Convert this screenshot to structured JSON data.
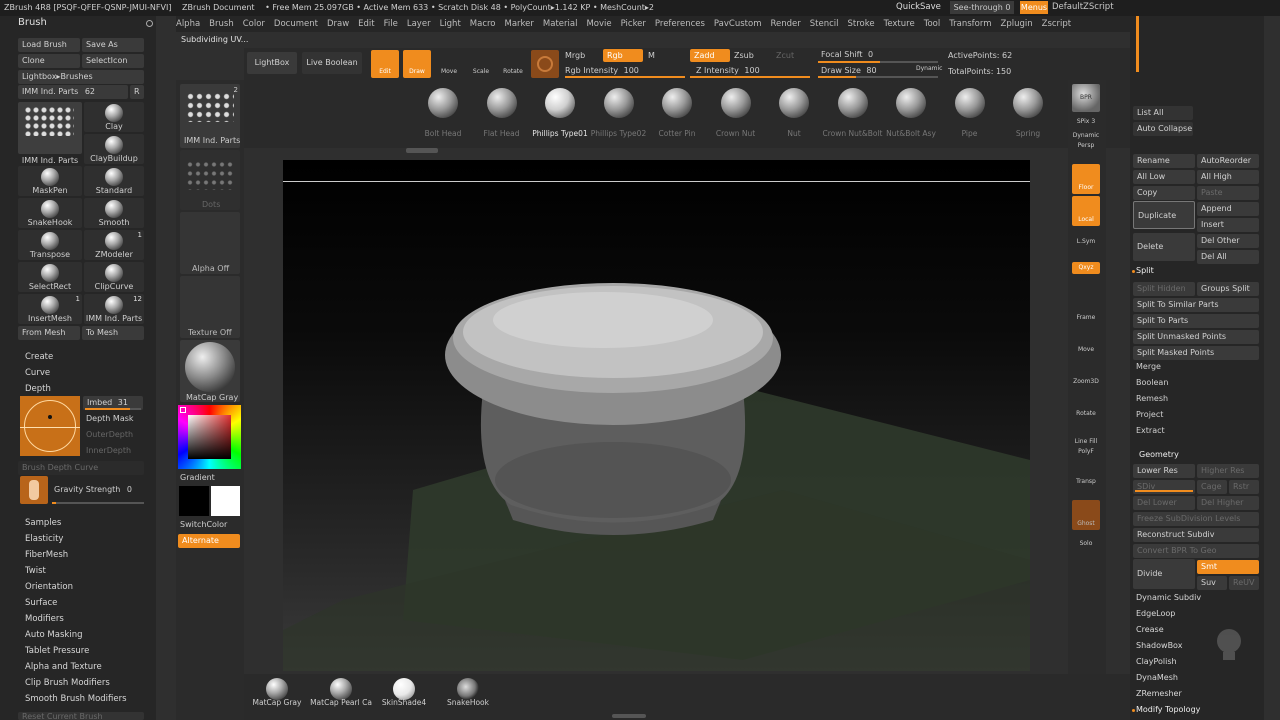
{
  "topbar": {
    "title": "ZBrush 4R8 [PSQF-QFEF-QSNP-JMUI-NFVI]",
    "doc": "ZBrush Document",
    "stats": "• Free Mem 25.097GB • Active Mem 633 • Scratch Disk 48 • PolyCount▸1.142 KP • MeshCount▸2",
    "quicksave": "QuickSave",
    "seethrough": "See-through 0",
    "menus": "Menus",
    "script": "DefaultZScript"
  },
  "menu": [
    "Alpha",
    "Brush",
    "Color",
    "Document",
    "Draw",
    "Edit",
    "File",
    "Layer",
    "Light",
    "Macro",
    "Marker",
    "Material",
    "Movie",
    "Picker",
    "Preferences",
    "PavCustom",
    "Render",
    "Stencil",
    "Stroke",
    "Texture",
    "Tool",
    "Transform",
    "Zplugin",
    "Zscript"
  ],
  "status": "Subdividing UV...",
  "brush": {
    "title": "Brush",
    "load": "Load Brush",
    "saveas": "Save As",
    "clone": "Clone",
    "selecticon": "SelectIcon",
    "lightbox": "Lightbox▸Brushes",
    "imm": "IMM Ind. Parts",
    "imm_value": "62",
    "r": "R",
    "grid": [
      {
        "label": "IMM Ind. Parts",
        "badge": ""
      },
      {
        "label": "Clay",
        "badge": ""
      },
      {
        "label": "ClayBuildup",
        "badge": ""
      },
      {
        "label": "MaskPen",
        "badge": ""
      },
      {
        "label": "Standard",
        "badge": ""
      },
      {
        "label": "SnakeHook",
        "badge": ""
      },
      {
        "label": "Smooth",
        "badge": ""
      },
      {
        "label": "Transpose",
        "badge": ""
      },
      {
        "label": "ZModeler",
        "badge": "1"
      },
      {
        "label": "SelectRect",
        "badge": ""
      },
      {
        "label": "ClipCurve",
        "badge": ""
      },
      {
        "label": "InsertMesh",
        "badge": "1"
      },
      {
        "label": "IMM Ind. Parts",
        "badge": "12"
      }
    ],
    "frommesh": "From Mesh",
    "tomesh": "To Mesh",
    "create": "Create",
    "curve": "Curve",
    "depth": "Depth",
    "embed": "Imbed",
    "embed_value": "31",
    "depthmask": "Depth Mask",
    "outerdepth": "OuterDepth",
    "innerdepth": "InnerDepth",
    "brushdepthcurve": "Brush Depth Curve",
    "gravity": "Gravity Strength",
    "gravity_value": "0",
    "sections": [
      "Samples",
      "Elasticity",
      "FiberMesh",
      "Twist",
      "Orientation",
      "Surface",
      "Modifiers",
      "Auto Masking",
      "Tablet Pressure",
      "Alpha and Texture",
      "Clip Brush Modifiers",
      "Smooth Brush Modifiers"
    ],
    "reset": "Reset Current Brush"
  },
  "shelf": {
    "imm": "IMM Ind. Parts",
    "imm_badge": "2",
    "dots": "Dots",
    "alpha": "Alpha Off",
    "texture": "Texture Off",
    "matcap": "MatCap Gray",
    "gradient": "Gradient",
    "switchcolor": "SwitchColor",
    "alternate": "Alternate"
  },
  "toolbar": {
    "lightbox": "LightBox",
    "liveboolean": "Live Boolean",
    "edit": "Edit",
    "draw": "Draw",
    "move": "Move",
    "scale": "Scale",
    "rotate": "Rotate",
    "mrgb": "Mrgb",
    "rgb": "Rgb",
    "m": "M",
    "zadd": "Zadd",
    "zsub": "Zsub",
    "zcut": "Zcut",
    "rgbint": "Rgb Intensity",
    "rgbint_value": "100",
    "zint": "Z Intensity",
    "zint_value": "100",
    "focal": "Focal Shift",
    "focal_value": "0",
    "drawsize": "Draw Size",
    "drawsize_value": "80",
    "dynamic": "Dynamic",
    "activepoints": "ActivePoints: 62",
    "totalpoints": "TotalPoints: 150"
  },
  "tools": [
    "Bolt Head",
    "Flat Head",
    "Phillips Type01",
    "Phillips Type02",
    "Cotter Pin",
    "Crown Nut",
    "Nut",
    "Crown Nut&Bolt",
    "Nut&Bolt Asy",
    "Pipe",
    "Spring"
  ],
  "rightshelf": {
    "bpr": "BPR",
    "spix": "SPix",
    "spix_value": "3",
    "dynamic": "Dynamic",
    "persp": "Persp",
    "floor": "Floor",
    "local": "Local",
    "lsym": "L.Sym",
    "xyz": "Qxyz",
    "frame": "Frame",
    "move": "Move",
    "zoom": "Zoom3D",
    "rotate": "Rotate",
    "linefill": "Line Fill",
    "polyf": "PolyF",
    "transp": "Transp",
    "ghost": "Ghost",
    "solo": "Solo"
  },
  "subtool": {
    "listall": "List All",
    "autocollapse": "Auto Collapse",
    "rename": "Rename",
    "autoreorder": "AutoReorder",
    "alllow": "All Low",
    "allhigh": "All High",
    "copy": "Copy",
    "paste": "Paste",
    "duplicate": "Duplicate",
    "append": "Append",
    "insert": "Insert",
    "delete": "Delete",
    "delother": "Del Other",
    "delall": "Del All",
    "split": "Split",
    "splithidden": "Split Hidden",
    "groupssplit": "Groups Split",
    "splitsimilar": "Split To Similar Parts",
    "splitparts": "Split To Parts",
    "splitunmasked": "Split Unmasked Points",
    "splitmasked": "Split Masked Points",
    "merge": "Merge",
    "boolean": "Boolean",
    "remesh": "Remesh",
    "project": "Project",
    "extract": "Extract"
  },
  "geometry": {
    "title": "Geometry",
    "lowerres": "Lower Res",
    "higherres": "Higher Res",
    "sdiv": "SDiv",
    "cage": "Cage",
    "rstr": "Rstr",
    "dellower": "Del Lower",
    "delhigher": "Del Higher",
    "freeze": "Freeze SubDivision Levels",
    "reconstruct": "Reconstruct Subdiv",
    "convertbpr": "Convert BPR To Geo",
    "divide": "Divide",
    "smt": "Smt",
    "suv": "Suv",
    "reuv": "ReUV",
    "items": [
      "Dynamic Subdiv",
      "EdgeLoop",
      "Crease",
      "ShadowBox",
      "ClayPolish",
      "DynaMesh",
      "ZRemesher"
    ],
    "modtopo": "Modify Topology"
  },
  "bottom": [
    "MatCap Gray",
    "MatCap Pearl Ca",
    "SkinShade4",
    "SnakeHook"
  ]
}
